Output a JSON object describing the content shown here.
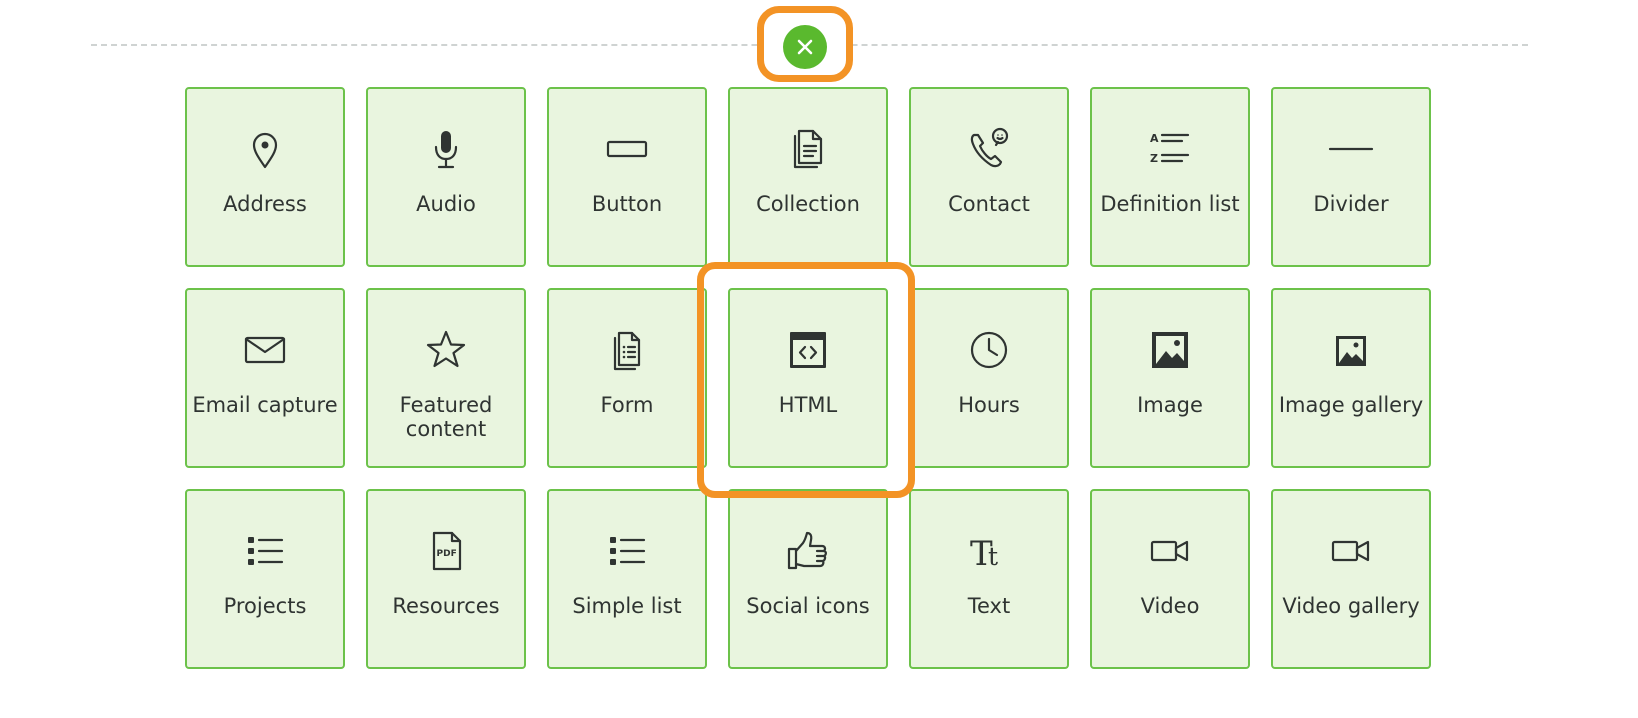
{
  "colors": {
    "accent": "#f39325",
    "tile_border": "#6cc24a",
    "tile_bg": "#e9f5df",
    "close_bg": "#5ab92e"
  },
  "close_button": {
    "icon": "close-icon"
  },
  "highlighted_tile": "HTML",
  "tiles": [
    {
      "label": "Address",
      "icon": "map-pin-icon"
    },
    {
      "label": "Audio",
      "icon": "microphone-icon"
    },
    {
      "label": "Button",
      "icon": "button-icon"
    },
    {
      "label": "Collection",
      "icon": "documents-icon"
    },
    {
      "label": "Contact",
      "icon": "phone-chat-icon"
    },
    {
      "label": "Definition list",
      "icon": "definition-list-icon"
    },
    {
      "label": "Divider",
      "icon": "divider-icon"
    },
    {
      "label": "Email capture",
      "icon": "envelope-icon"
    },
    {
      "label": "Featured content",
      "icon": "star-icon"
    },
    {
      "label": "Form",
      "icon": "form-icon"
    },
    {
      "label": "HTML",
      "icon": "html-code-icon"
    },
    {
      "label": "Hours",
      "icon": "clock-icon"
    },
    {
      "label": "Image",
      "icon": "image-icon"
    },
    {
      "label": "Image gallery",
      "icon": "image-gallery-icon"
    },
    {
      "label": "Projects",
      "icon": "list-icon"
    },
    {
      "label": "Resources",
      "icon": "pdf-icon"
    },
    {
      "label": "Simple list",
      "icon": "simple-list-icon"
    },
    {
      "label": "Social icons",
      "icon": "thumbs-up-icon"
    },
    {
      "label": "Text",
      "icon": "text-icon"
    },
    {
      "label": "Video",
      "icon": "video-camera-icon"
    },
    {
      "label": "Video gallery",
      "icon": "video-gallery-icon"
    }
  ]
}
